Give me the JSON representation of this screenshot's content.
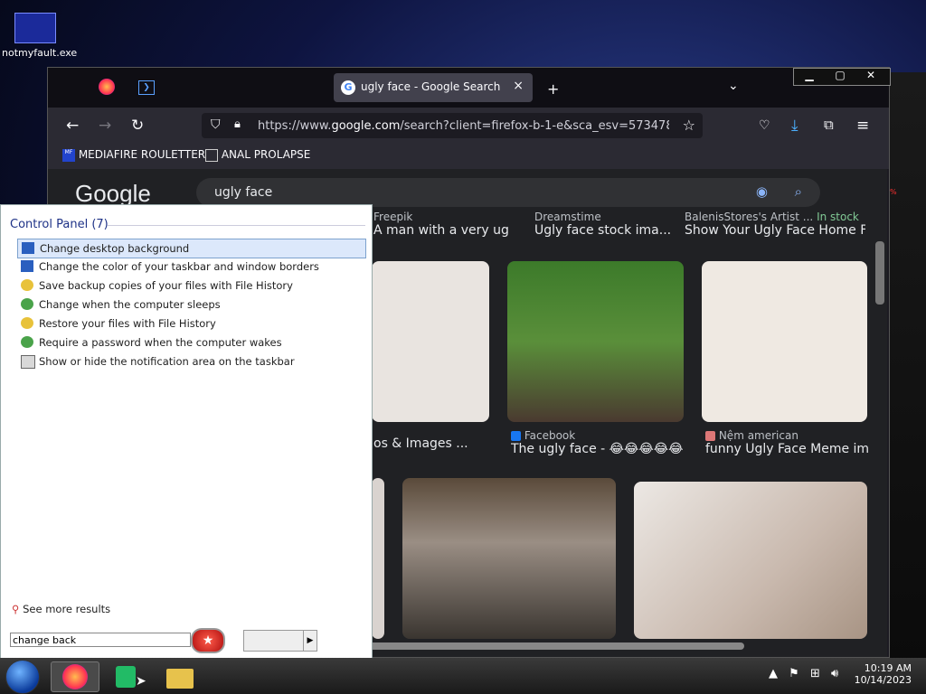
{
  "desktop": {
    "icon_label": "notmyfault.exe"
  },
  "browser": {
    "tab_title": "ugly face - Google Search",
    "tab_close": "×",
    "new_tab": "+",
    "url_prefix": "https://www.",
    "url_domain": "google.com",
    "url_rest": "/search?client=firefox-b-1-e&sca_esv=573478320",
    "bookmarks": [
      {
        "label": "MEDIAFIRE ROULETTER"
      },
      {
        "label": "ANAL PROLAPSE"
      }
    ],
    "window_controls": [
      "▁",
      "▢",
      "✕"
    ]
  },
  "google": {
    "logo": "Google",
    "query": "ugly face",
    "row1": [
      {
        "source": "Freepik",
        "title": "A man with a very ugl..."
      },
      {
        "source": "Dreamstime",
        "title": "Ugly face stock ima..."
      },
      {
        "source": "BalenisStores's Artist ...",
        "badge": "In stock",
        "title": "Show Your Ugly Face Home F..."
      }
    ],
    "row2": [
      {
        "source": "",
        "title": "os & Images ..."
      },
      {
        "source": "Facebook",
        "title": "The ugly face - 😂😂😂😂😂 |..."
      },
      {
        "source": "Nệm american",
        "title": "funny Ugly Face Meme im..."
      }
    ]
  },
  "start_menu": {
    "heading": "Control Panel (7)",
    "items": [
      {
        "label": "Change desktop background"
      },
      {
        "label": "Change the color of your taskbar and window borders"
      },
      {
        "label": "Save backup copies of your files with File History"
      },
      {
        "label": "Change when the computer sleeps"
      },
      {
        "label": "Restore your files with File History"
      },
      {
        "label": "Require a password when the computer wakes"
      },
      {
        "label": "Show or hide the notification area on the taskbar"
      }
    ],
    "see_more": "See more results",
    "search_value": "change back"
  },
  "taskbar": {
    "time": "10:19 AM",
    "date": "10/14/2023"
  },
  "colors": {
    "accent": "#7da2ce",
    "browser_bg": "#202124"
  }
}
